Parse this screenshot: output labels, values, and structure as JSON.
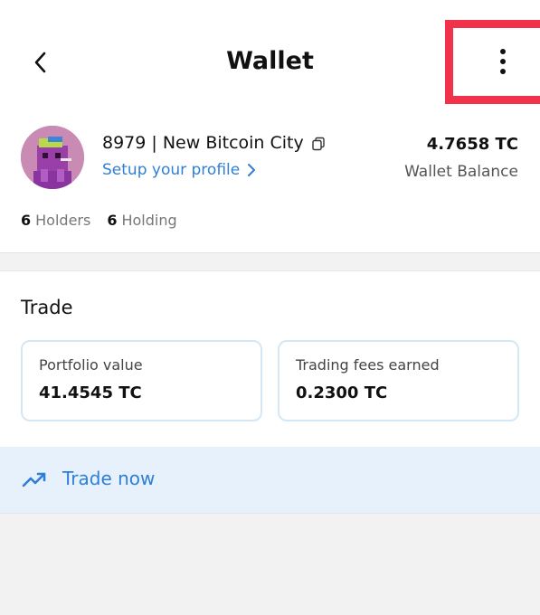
{
  "header": {
    "title": "Wallet",
    "back_icon": "chevron-left-icon",
    "more_icon": "more-vertical-icon",
    "highlight_color": "#f0334a"
  },
  "profile": {
    "name": "8979 | New Bitcoin City",
    "copy_icon": "copy-icon",
    "setup_link": "Setup your profile",
    "balance": "4.7658 TC",
    "balance_label": "Wallet Balance",
    "holders_count": "6",
    "holders_label": "Holders",
    "holding_count": "6",
    "holding_label": "Holding"
  },
  "trade": {
    "title": "Trade",
    "cards": [
      {
        "label": "Portfolio value",
        "value": "41.4545 TC"
      },
      {
        "label": "Trading fees earned",
        "value": "0.2300 TC"
      }
    ],
    "action_label": "Trade now",
    "action_icon": "trending-up-icon"
  },
  "colors": {
    "accent": "#2f7fd6",
    "card_border": "#d3e8f4",
    "action_bg": "#e6f1fb"
  }
}
